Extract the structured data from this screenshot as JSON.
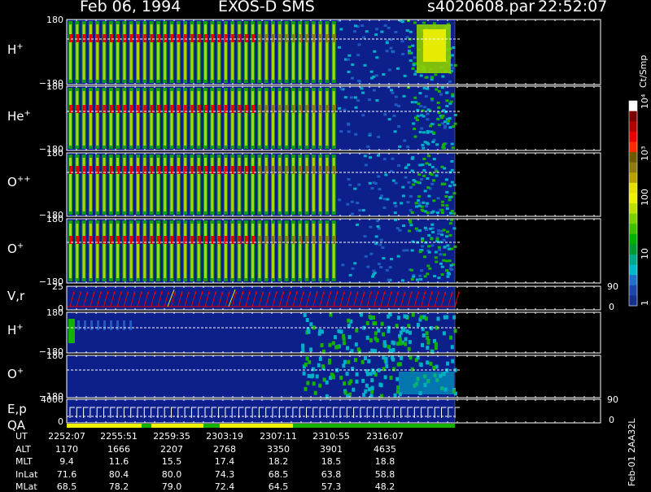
{
  "header": {
    "date": "Feb 06, 1994",
    "mission": "EXOS-D SMS",
    "file": "s4020608.par",
    "time": "22:52:07"
  },
  "colorbar": {
    "unit": "Ct/Smp",
    "ticks": [
      "10⁴",
      "10³",
      "100",
      "10",
      "1"
    ],
    "colors": [
      "#ffffff",
      "#7a0000",
      "#b00000",
      "#e60000",
      "#ff2a00",
      "#6e5a00",
      "#8e7a10",
      "#b8a000",
      "#e8e000",
      "#f0f000",
      "#bde000",
      "#7ccf00",
      "#3fbf00",
      "#00b000",
      "#009a30",
      "#00a88a",
      "#00b8c8",
      "#1e70c8",
      "#1e46a8",
      "#15308a"
    ]
  },
  "panels": [
    {
      "id": "h-plus",
      "label": "H",
      "sup": "+",
      "ytop": "180",
      "ybot": "−180"
    },
    {
      "id": "he-plus",
      "label": "He",
      "sup": "+",
      "ytop": "180",
      "ybot": "−180"
    },
    {
      "id": "o-plusplus",
      "label": "O",
      "sup": "++",
      "ytop": "180",
      "ybot": "−180"
    },
    {
      "id": "o-plus",
      "label": "O",
      "sup": "+",
      "ytop": "180",
      "ybot": "−180"
    },
    {
      "id": "vr",
      "label": "V,r",
      "sup": "",
      "ytop": "25",
      "ybot": "0",
      "rtop": "90",
      "rbot": "0"
    },
    {
      "id": "h-plus-2",
      "label": "H",
      "sup": "+",
      "ytop": "180",
      "ybot": "−180"
    },
    {
      "id": "o-plus-2",
      "label": "O",
      "sup": "+",
      "ytop": "180",
      "ybot": "−180"
    },
    {
      "id": "ep",
      "label": "E,p",
      "sup": "",
      "label2": "QA",
      "ytop": "4000",
      "ybot": "0",
      "rtop": "90",
      "rbot": "0"
    }
  ],
  "annotation": "Feb-01 2AA32L",
  "chart_data": {
    "type": "heatmap",
    "title": "Feb 06, 1994   EXOS-D SMS   s4020608.par  22:52:07",
    "x_label": "UT",
    "x_ticks": [
      "2252:07",
      "2255:51",
      "2259:35",
      "2303:19",
      "2307:11",
      "2310:55",
      "2316:07"
    ],
    "color_scale": "log",
    "color_range": [
      1,
      10000
    ],
    "ephemeris": [
      {
        "name": "UT",
        "values": [
          "2252:07",
          "2255:51",
          "2259:35",
          "2303:19",
          "2307:11",
          "2310:55",
          "2316:07"
        ]
      },
      {
        "name": "ALT",
        "values": [
          "1170",
          "1666",
          "2207",
          "2768",
          "3350",
          "3901",
          "4635"
        ]
      },
      {
        "name": "MLT",
        "values": [
          "9.4",
          "11.6",
          "15.5",
          "17.4",
          "18.2",
          "18.5",
          "18.8"
        ]
      },
      {
        "name": "InLat",
        "values": [
          "71.6",
          "80.4",
          "80.0",
          "74.3",
          "68.5",
          "63.8",
          "58.8"
        ]
      },
      {
        "name": "MLat",
        "values": [
          "68.5",
          "78.2",
          "79.0",
          "72.4",
          "64.5",
          "57.3",
          "48.2"
        ]
      }
    ]
  }
}
